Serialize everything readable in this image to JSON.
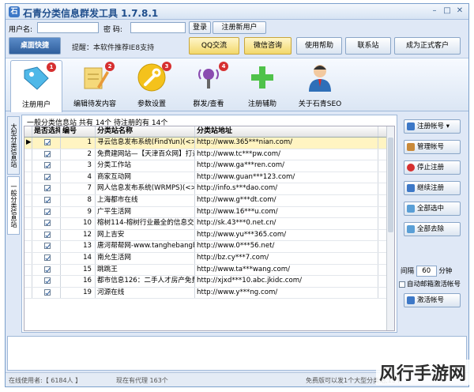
{
  "title": "石青分类信息群发工具 1.7.8.1",
  "login": {
    "user_label": "用户名:",
    "pwd_label": "密  码:",
    "login_btn": "登录",
    "register_btn": "注册新用户"
  },
  "toolbar": {
    "desktop_shortcut": "桌面快捷",
    "tip": "提醒：本软件推荐IE8支持",
    "qq": "QQ交流",
    "wechat": "微信咨询",
    "help": "使用帮助",
    "other_site": "联系站",
    "become_customer": "成为正式客户"
  },
  "nav": [
    {
      "label": "注册用户",
      "badge": "1",
      "icon": "tag-icon"
    },
    {
      "label": "编辑待发内容",
      "badge": "2",
      "icon": "edit-icon"
    },
    {
      "label": "参数设置",
      "badge": "3",
      "icon": "wrench-icon"
    },
    {
      "label": "群发/查看",
      "badge": "4",
      "icon": "broadcast-icon"
    },
    {
      "label": "注册辅助",
      "badge": "",
      "icon": "plus-icon"
    },
    {
      "label": "关于石青SEO",
      "badge": "",
      "icon": "person-icon"
    }
  ],
  "vtabs": [
    "大型分类信息站",
    "一般分类信息站"
  ],
  "grid": {
    "caption": "一般分类信息站 共有 14个 待注册的有 14个",
    "headers": [
      "是否选择",
      "编号",
      "分类站名称",
      "分类站地址"
    ],
    "rows": [
      {
        "no": "1",
        "name": "寻云信息发布系统(FindYun)(<>最",
        "url": "http://www.365***nian.com/"
      },
      {
        "no": "2",
        "name": "免费建网站—【天津百众网】打造",
        "url": "http://www.tc***pw.com/"
      },
      {
        "no": "3",
        "name": "分类工作站",
        "url": "http://www.ga***ren.com/"
      },
      {
        "no": "4",
        "name": "商家互动网",
        "url": "http://www.guan***123.com/"
      },
      {
        "no": "7",
        "name": "网人信息发布系统(WRMPS)(<>最",
        "url": "http://info.s***dao.com/"
      },
      {
        "no": "8",
        "name": "上海都市在线",
        "url": "http://www.g***dt.com/"
      },
      {
        "no": "9",
        "name": "广平生活网",
        "url": "http://www.16***u.com/"
      },
      {
        "no": "10",
        "name": "榕树114-榕树行业最全的信息交流",
        "url": "http://sk.43***0.net.cn/"
      },
      {
        "no": "12",
        "name": "网上吉安",
        "url": "http://www.yu***365.com/"
      },
      {
        "no": "13",
        "name": "唐河帮帮网-www.tanghebangbang",
        "url": "http://www.0***56.net/"
      },
      {
        "no": "14",
        "name": "南允生活网",
        "url": "http://bz.cy***7.com/"
      },
      {
        "no": "15",
        "name": "跳跳王",
        "url": "http://www.ta***wang.com/"
      },
      {
        "no": "16",
        "name": "都市信息126：二手人才房产免费",
        "url": "http://xjxd***10.abc.jkidc.com/"
      },
      {
        "no": "19",
        "name": "河源在线",
        "url": "http://www.y***ng.com/"
      }
    ]
  },
  "side": {
    "register_account": "注册帐号",
    "manage_account": "管理帐号",
    "stop_register": "停止注册",
    "continue_register": "继续注册",
    "select_all": "全部选中",
    "deselect_all": "全部去除",
    "interval_label": "间隔",
    "interval_value": "60",
    "interval_unit": "分钟",
    "auto_email": "自动邮箱激活帐号",
    "activate": "激活帐号"
  },
  "status": {
    "online_users": "在线使用者:【 6184人 】",
    "proxies": "现在有代理 163个",
    "free_note": "免费版可以发1个大型分类站,15个"
  },
  "watermark": "风行手游网",
  "colors": {
    "accent": "#1f4e8c",
    "selected_row": "#fff4c2",
    "badge": "#d63030"
  }
}
